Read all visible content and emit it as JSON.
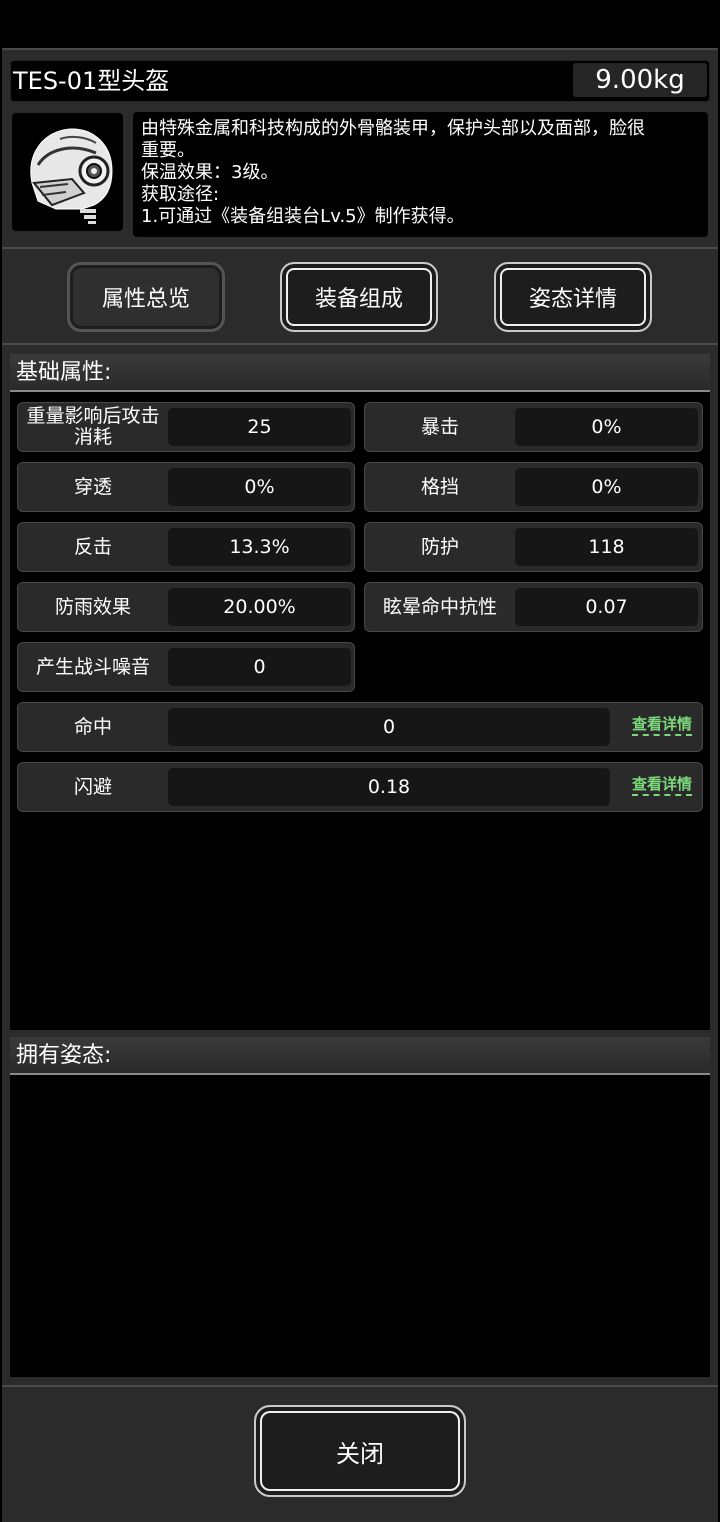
{
  "item": {
    "name": "TES-01型头盔",
    "weight": "9.00kg",
    "icon": "helmet-icon",
    "description": [
      "由特殊金属和科技构成的外骨骼装甲，保护头部以及面部，脸很",
      "重要。",
      "保温效果：3级。",
      "获取途径:",
      "1.可通过《装备组装台Lv.5》制作获得。"
    ]
  },
  "tabs": [
    {
      "label": "属性总览"
    },
    {
      "label": "装备组成"
    },
    {
      "label": "姿态详情"
    }
  ],
  "basic": {
    "title": "基础属性:",
    "stats": [
      {
        "label": "重量影响后攻击消耗",
        "value": "25"
      },
      {
        "label": "暴击",
        "value": "0%"
      },
      {
        "label": "穿透",
        "value": "0%"
      },
      {
        "label": "格挡",
        "value": "0%"
      },
      {
        "label": "反击",
        "value": "13.3%"
      },
      {
        "label": "防护",
        "value": "118"
      },
      {
        "label": "防雨效果",
        "value": "20.00%"
      },
      {
        "label": "眩晕命中抗性",
        "value": "0.07"
      },
      {
        "label": "产生战斗噪音",
        "value": "0"
      }
    ],
    "wide_stats": [
      {
        "label": "命中",
        "value": "0",
        "link": "查看详情"
      },
      {
        "label": "闪避",
        "value": "0.18",
        "link": "查看详情"
      }
    ]
  },
  "postures": {
    "title": "拥有姿态:"
  },
  "close_label": "关闭",
  "colors": {
    "panel": "#2b2b2b",
    "link": "#7cd87c"
  }
}
